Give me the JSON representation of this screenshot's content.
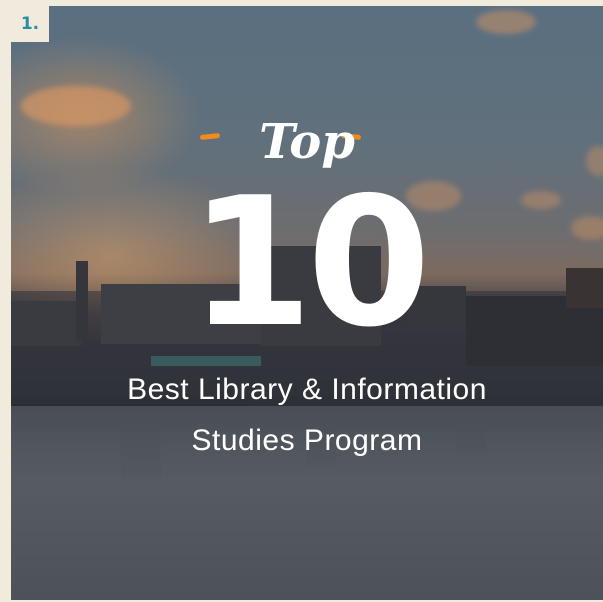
{
  "badge": {
    "number": "1."
  },
  "headline": {
    "top_word": "Top",
    "number": "10",
    "line1": "Best Library & Information",
    "line2": "Studies Program"
  },
  "colors": {
    "accent_orange": "#f28a1c",
    "badge_teal": "#2a8fa6",
    "frame_cream": "#f1ebdd",
    "text": "#ffffff"
  },
  "icons": {
    "decor": "orange-dash-accents"
  }
}
